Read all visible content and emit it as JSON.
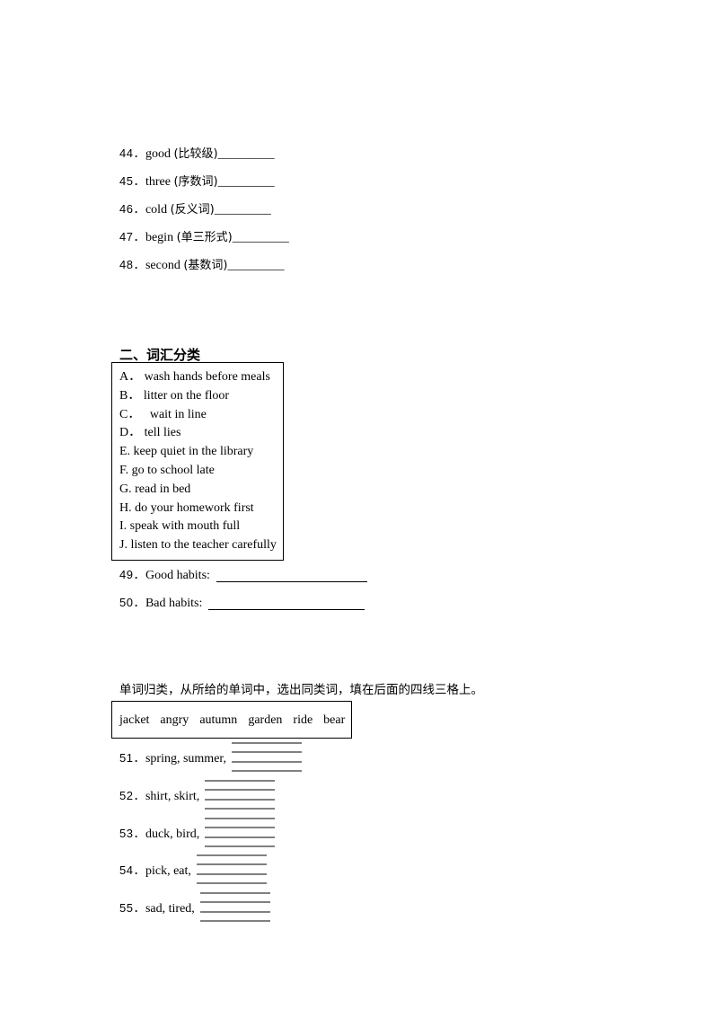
{
  "section1": {
    "questions": [
      {
        "num": "44．",
        "word": "good",
        "hint": "(比较级)",
        "blank": "_________"
      },
      {
        "num": "45．",
        "word": "three",
        "hint": "(序数词)",
        "blank": "_________"
      },
      {
        "num": "46．",
        "word": "cold",
        "hint": "(反义词)",
        "blank": "_________"
      },
      {
        "num": "47．",
        "word": "begin",
        "hint": "(单三形式)",
        "blank": "_________"
      },
      {
        "num": "48．",
        "word": "second",
        "hint": "(基数词)",
        "blank": "_________"
      }
    ]
  },
  "section2": {
    "title": "二、词汇分类",
    "options": [
      "A． wash hands before meals",
      "B． litter on the floor",
      "C．   wait in line",
      "D． tell lies",
      "E. keep quiet in the library",
      "F. go to school late",
      "G. read in bed",
      "H. do your homework first",
      "I. speak with mouth full",
      "J. listen to the teacher carefully"
    ],
    "questions": [
      {
        "num": "49．",
        "label": "Good habits:"
      },
      {
        "num": "50．",
        "label": "Bad habits:"
      }
    ]
  },
  "section3": {
    "instruction": "单词归类，从所给的单词中，选出同类词，填在后面的四线三格上。",
    "word_bank": [
      "jacket",
      "angry",
      "autumn",
      "garden",
      "ride",
      "bear"
    ],
    "questions": [
      {
        "num": "51．",
        "words": "spring, summer,"
      },
      {
        "num": "52．",
        "words": "shirt, skirt,"
      },
      {
        "num": "53．",
        "words": "duck, bird,"
      },
      {
        "num": "54．",
        "words": "pick, eat,"
      },
      {
        "num": "55．",
        "words": "sad, tired,"
      }
    ]
  }
}
